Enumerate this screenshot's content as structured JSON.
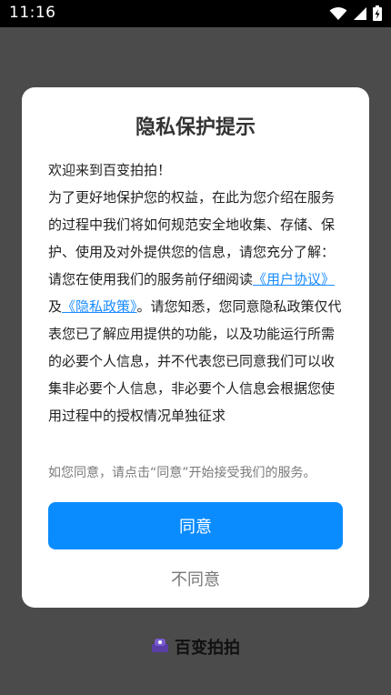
{
  "status_bar": {
    "time": "11:16",
    "icons": [
      "wifi-icon",
      "cellular-signal-icon",
      "battery-charging-icon"
    ]
  },
  "dialog": {
    "title": "隐私保护提示",
    "paragraphs": {
      "welcome": "欢迎来到百变拍拍！",
      "intro": "为了更好地保护您的权益，在此为您介绍在服务的过程中我们将如何规范安全地收集、存储、保护、使用及对外提供您的信息，请您充分了解：",
      "read_prefix": "请您在使用我们的服务前仔细阅读",
      "link_user_agreement": "《用户协议》",
      "read_and": "及",
      "link_privacy_policy": "《隐私政策》",
      "read_suffix": "。请您知悉，您同意隐私政策仅代表您已了解应用提供的功能，以及功能运行所需的必要个人信息，并不代表您已同意我们可以收集非必要个人信息，非必要个人信息会根据您使用过程中的授权情况单独征求"
    },
    "hint": "如您同意，请点击“同意”开始接受我们的服务。",
    "agree_label": "同意",
    "disagree_label": "不同意"
  },
  "footer": {
    "brand": "百变拍拍",
    "icon": "app-logo-icon"
  },
  "colors": {
    "accent": "#0a8cff",
    "link": "#1a8cff",
    "overlay": "#4b4b4b"
  }
}
